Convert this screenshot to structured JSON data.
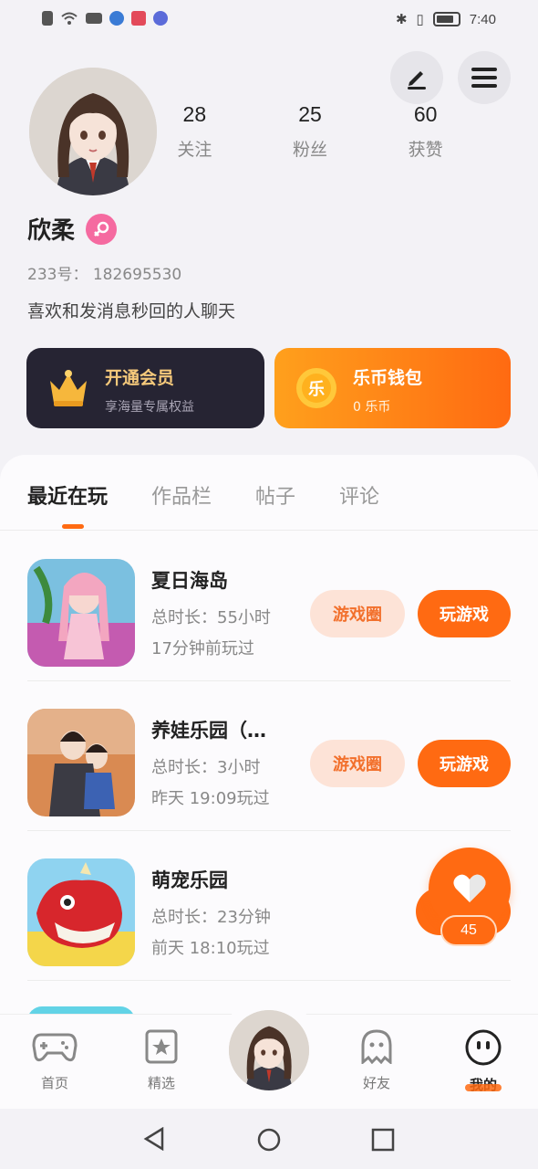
{
  "status_bar": {
    "time": "7:40"
  },
  "profile": {
    "name": "欣柔",
    "uid_label": "233号：",
    "uid": "182695530",
    "bio": "喜欢和发消息秒回的人聊天",
    "stats": [
      {
        "value": "28",
        "label": "关注"
      },
      {
        "value": "25",
        "label": "粉丝"
      },
      {
        "value": "60",
        "label": "获赞"
      }
    ]
  },
  "cards": {
    "vip": {
      "title": "开通会员",
      "subtitle": "享海量专属权益"
    },
    "coin": {
      "title": "乐币钱包",
      "subtitle": "0 乐币",
      "icon_text": "乐"
    }
  },
  "tabs": [
    "最近在玩",
    "作品栏",
    "帖子",
    "评论"
  ],
  "games": [
    {
      "title": "夏日海岛",
      "duration": "总时长：55小时",
      "last_played": "17分钟前玩过",
      "circle_btn": "游戏圈",
      "play_btn": "玩游戏"
    },
    {
      "title": "养娃乐园（…",
      "duration": "总时长：3小时",
      "last_played": "昨天 19:09玩过",
      "circle_btn": "游戏圈",
      "play_btn": "玩游戏"
    },
    {
      "title": "萌宠乐园",
      "duration": "总时长：23分钟",
      "last_played": "前天 18:10玩过"
    }
  ],
  "like_count": "45",
  "nav": {
    "home": "首页",
    "featured": "精选",
    "friends": "好友",
    "mine": "我的"
  },
  "colors": {
    "accent": "#ff6a12",
    "vip_bg": "#262433",
    "gold": "#f5c97b"
  }
}
